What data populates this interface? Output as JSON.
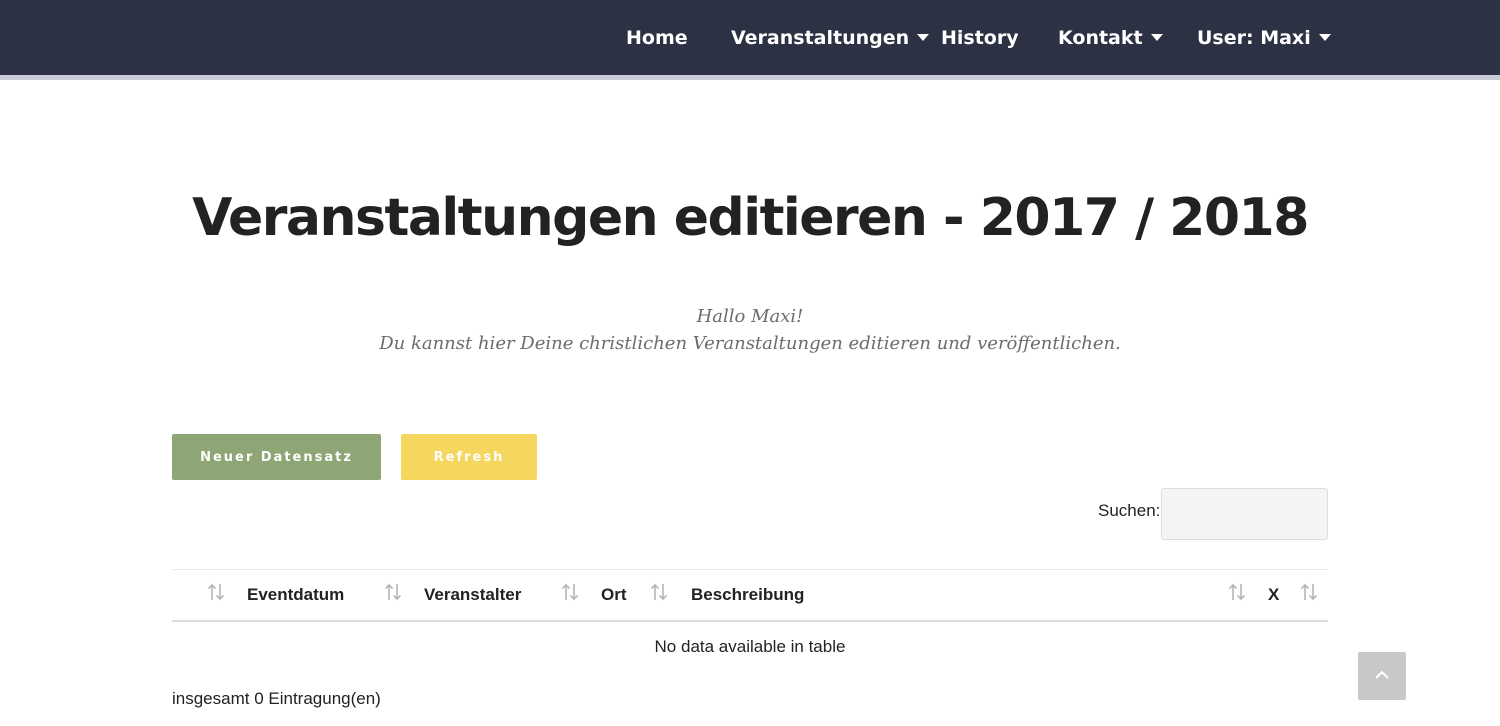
{
  "nav": {
    "items": [
      {
        "label": "Home",
        "dropdown": false
      },
      {
        "label": "Veranstaltungen",
        "dropdown": true
      },
      {
        "label": "History",
        "dropdown": false
      },
      {
        "label": "Kontakt",
        "dropdown": true
      },
      {
        "label": "User: Maxi",
        "dropdown": true
      }
    ]
  },
  "page": {
    "title": "Veranstaltungen editieren - 2017 / 2018",
    "greeting": "Hallo Maxi!",
    "subtitle": "Du kannst hier Deine christlichen Veranstaltungen editieren und veröffentlichen."
  },
  "actions": {
    "new_label": "Neuer Datensatz",
    "refresh_label": "Refresh"
  },
  "search": {
    "label": "Suchen:",
    "value": ""
  },
  "table": {
    "columns": [
      "",
      "Eventdatum",
      "Veranstalter",
      "Ort",
      "Beschreibung",
      "X"
    ],
    "empty_message": "No data available in table",
    "info": "insgesamt 0 Eintragung(en)"
  },
  "colors": {
    "navbar": "#2c3143",
    "btn_new": "#8ea676",
    "btn_refresh": "#f5d65f"
  },
  "icons": {
    "sort": "sort-arrows-icon",
    "caret": "caret-down-icon",
    "back_to_top": "chevron-up-icon"
  }
}
